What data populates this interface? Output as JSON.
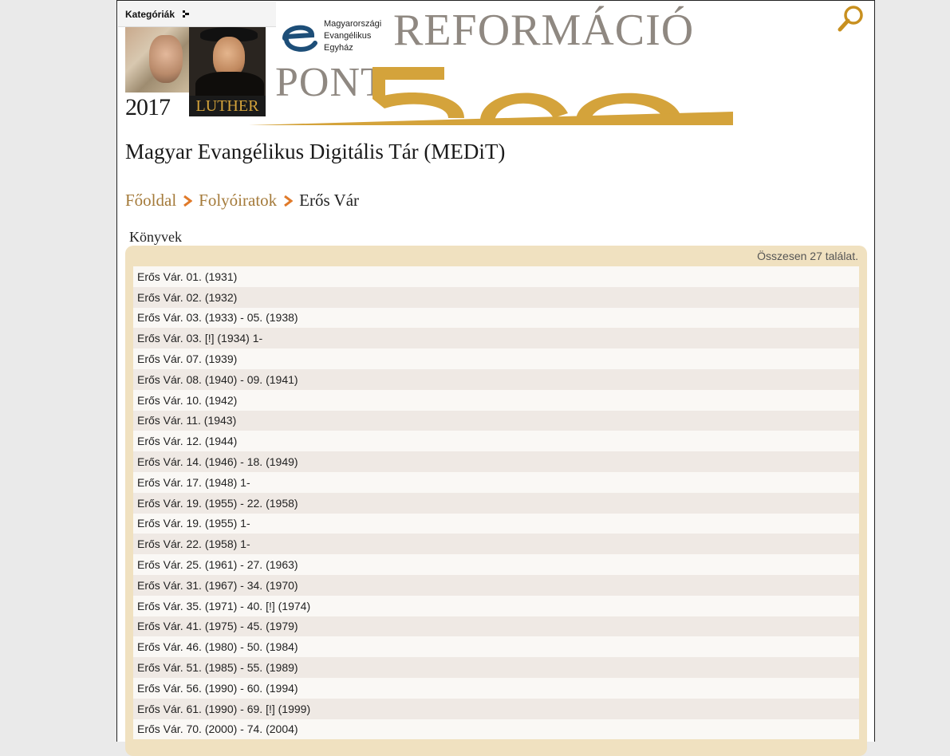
{
  "header": {
    "categories_label": "Kategóriák",
    "church_name_line1": "Magyarországi",
    "church_name_line2": "Evangélikus",
    "church_name_line3": "Egyház",
    "banner_title": "REFORMÁCIÓ",
    "banner_pont": "PONT",
    "banner_year": "2017",
    "banner_luther": "LUTHER"
  },
  "site_title": "Magyar Evangélikus Digitális Tár (MEDiT)",
  "breadcrumb": {
    "home": "Főoldal",
    "periodicals": "Folyóiratok",
    "current": "Erős Vár"
  },
  "section_label": "Könyvek",
  "results": {
    "count_text": "Összesen 27 találat.",
    "items": [
      "Erős Vár. 01. (1931)",
      "Erős Vár. 02. (1932)",
      "Erős Vár. 03. (1933) - 05. (1938)",
      "Erős Vár. 03. [!] (1934) 1-",
      "Erős Vár. 07. (1939)",
      "Erős Vár. 08. (1940) - 09. (1941)",
      "Erős Vár. 10. (1942)",
      "Erős Vár. 11. (1943)",
      "Erős Vár. 12. (1944)",
      "Erős Vár. 14. (1946) - 18. (1949)",
      "Erős Vár. 17. (1948) 1-",
      "Erős Vár. 19. (1955) - 22. (1958)",
      "Erős Vár. 19. (1955) 1-",
      "Erős Vár. 22. (1958) 1-",
      "Erős Vár. 25. (1961) - 27. (1963)",
      "Erős Vár. 31. (1967) - 34. (1970)",
      "Erős Vár. 35. (1971) - 40. [!] (1974)",
      "Erős Vár. 41. (1975) - 45. (1979)",
      "Erős Vár. 46. (1980) - 50. (1984)",
      "Erős Vár. 51. (1985) - 55. (1989)",
      "Erős Vár. 56. (1990) - 60. (1994)",
      "Erős Vár. 61. (1990) - 69. [!] (1999)",
      "Erős Vár. 70. (2000) - 74. (2004)"
    ]
  },
  "colors": {
    "accent_gold": "#d4a33b",
    "breadcrumb_link": "#a47a3a",
    "panel_bg": "#f0e1c0",
    "search_icon": "#c8901f"
  },
  "icons": {
    "search": "search-icon",
    "categories_arrow": "chevron-right-icon",
    "breadcrumb_separator": "chevron-right-icon"
  }
}
